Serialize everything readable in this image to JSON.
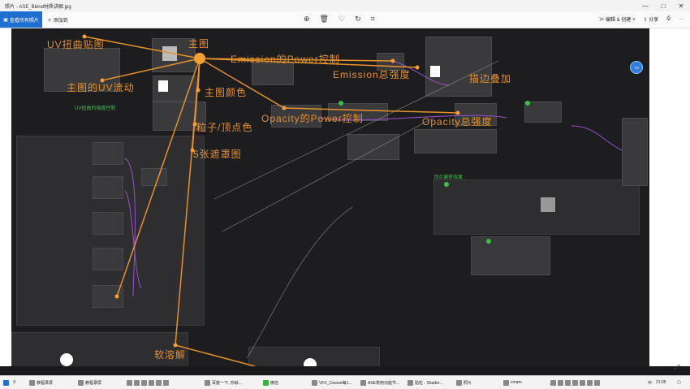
{
  "window": {
    "title": "照片 - ASE_Blend材质讲解.jpg",
    "controls": [
      "—",
      "□",
      "✕"
    ]
  },
  "toolbar": {
    "view_all_label": "查看所有照片",
    "add_label": "添加到",
    "edit_label": "编辑 & 创建",
    "share_label": "分享",
    "more_label": "···"
  },
  "annotations": {
    "uv_distort": "UV扭曲贴图",
    "main_tex": "主图",
    "main_uv_flow": "主图的UV流动",
    "main_color": "主图颜色",
    "particle_vertex": "粒子/顶点色",
    "five_masks": "5张遮罩图",
    "emission_power": "Emission的Power控制",
    "emission_total": "Emission总强度",
    "outline_add": "描边叠加",
    "opacity_power": "Opacity的Power控制",
    "opacity_total": "Opacity总强度",
    "soft_dissolve": "软溶解",
    "green_uv": "UV扭曲的强度控制",
    "green_vertex": "顶点偏移效果"
  },
  "taskbar": {
    "items": [
      "教程录屏",
      "教程录屏",
      "百度一下, 你就...",
      "微信",
      "VFX_Course每1...",
      "ASE常用功能节...",
      "贴粒 - Shader...",
      "照片",
      "cmam"
    ],
    "time": "21:05",
    "lang": "中"
  }
}
